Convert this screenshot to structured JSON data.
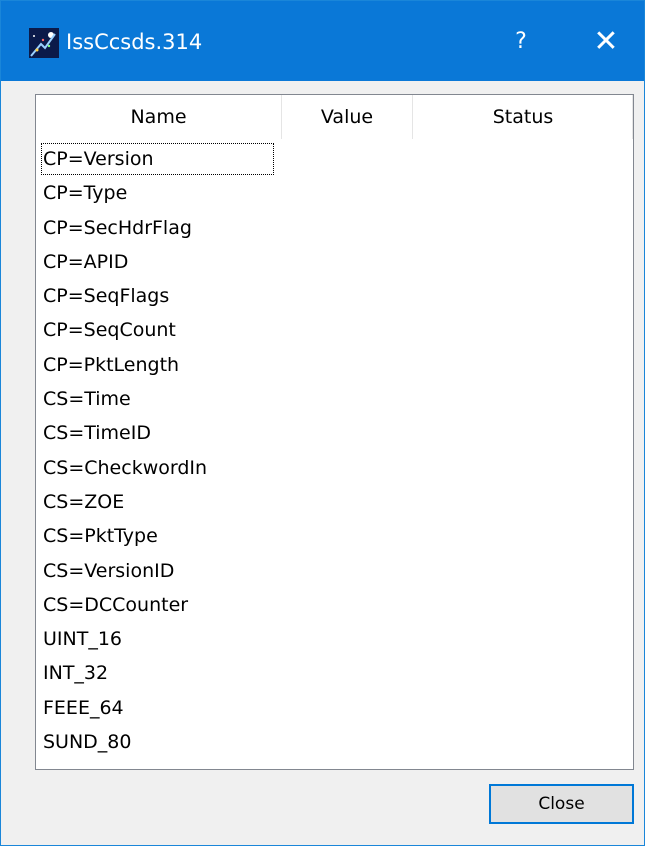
{
  "window": {
    "title": "IssCcsds.314",
    "help_label": "?",
    "close_glyph": "✕",
    "titlebar_color": "#0a78d7"
  },
  "table": {
    "columns": [
      "Name",
      "Value",
      "Status"
    ],
    "rows": [
      "CP=Version",
      "CP=Type",
      "CP=SecHdrFlag",
      "CP=APID",
      "CP=SeqFlags",
      "CP=SeqCount",
      "CP=PktLength",
      "CS=Time",
      "CS=TimeID",
      "CS=CheckwordIn",
      "CS=ZOE",
      "CS=PktType",
      "CS=VersionID",
      "CS=DCCounter",
      "UINT_16",
      "INT_32",
      "FEEE_64",
      "SUND_80"
    ],
    "focused_row": 0
  },
  "footer": {
    "close_label": "Close"
  }
}
